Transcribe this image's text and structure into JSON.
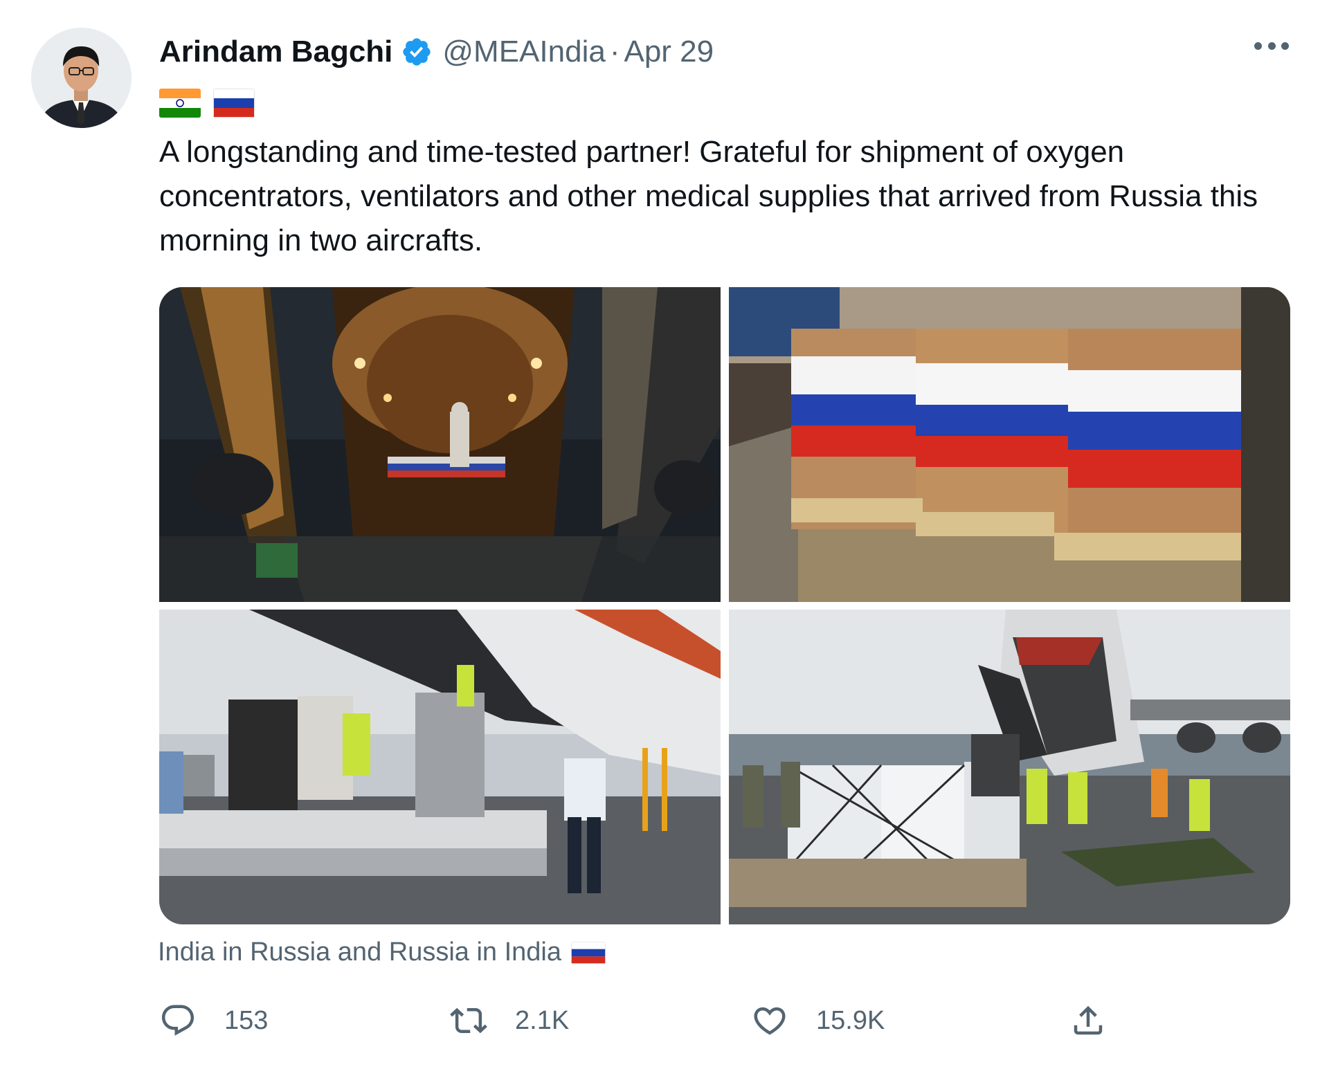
{
  "author": {
    "name": "Arindam Bagchi",
    "handle": "@MEAIndia",
    "separator": "·",
    "date": "Apr 29",
    "verified": true
  },
  "flags": [
    {
      "icon": "india-flag-icon",
      "country": "India"
    },
    {
      "icon": "russia-flag-icon",
      "country": "Russia"
    }
  ],
  "tweet_text": "A longstanding and time-tested partner! Grateful for shipment of oxygen concentrators, ventilators and other medical supplies that arrived from Russia this morning in two aircrafts.",
  "media": [
    {
      "icon": "photo-aircraft-cargo-hold"
    },
    {
      "icon": "photo-boxes-russian-flag-pallets"
    },
    {
      "icon": "photo-cargo-loader-tarmac"
    },
    {
      "icon": "photo-unloading-wrapped-cargo"
    }
  ],
  "caption": {
    "text": "India in Russia and Russia in India",
    "flag_icon": "russia-flag-icon"
  },
  "actions": {
    "reply": {
      "icon": "reply-icon",
      "count": "153"
    },
    "retweet": {
      "icon": "retweet-icon",
      "count": "2.1K"
    },
    "like": {
      "icon": "heart-icon",
      "count": "15.9K"
    },
    "share": {
      "icon": "share-icon"
    }
  },
  "colors": {
    "text": "#0f1419",
    "secondary": "#536471",
    "verified_blue": "#1d9bf0",
    "russia_white": "#ffffff",
    "russia_blue": "#1c3fae",
    "russia_red": "#d52b1e",
    "india_saffron": "#ff9933",
    "india_green": "#138808"
  }
}
